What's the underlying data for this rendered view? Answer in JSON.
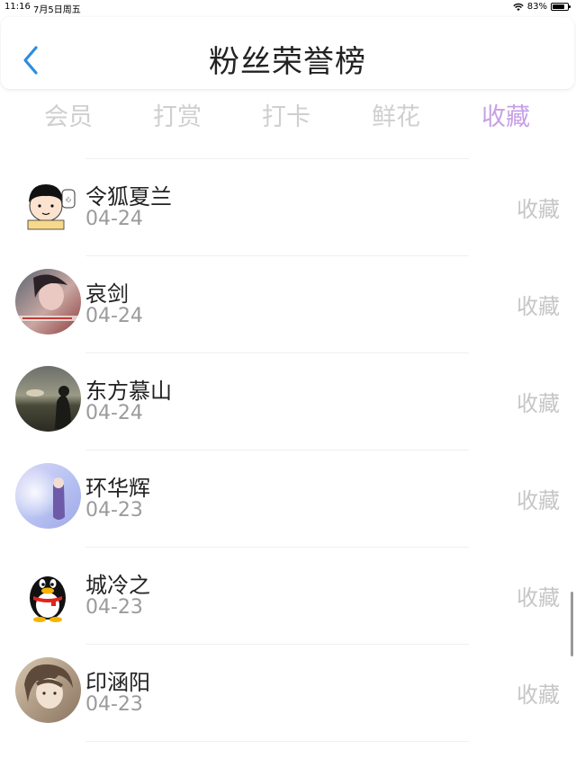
{
  "status_bar": {
    "time": "11:16",
    "date": "7月5日周五",
    "battery": "83%",
    "battery_level": 0.83
  },
  "header": {
    "title": "粉丝荣誉榜",
    "back_icon": "chevron-left-icon",
    "back_color": "#2d8de0"
  },
  "tabs": [
    {
      "label": "会员",
      "active": false
    },
    {
      "label": "打赏",
      "active": false
    },
    {
      "label": "打卡",
      "active": false
    },
    {
      "label": "鲜花",
      "active": false
    },
    {
      "label": "收藏",
      "active": true
    }
  ],
  "accent_color": "#c7a0e6",
  "fans": [
    {
      "name": "令狐夏兰",
      "date": "04-24",
      "action": "收藏",
      "avatar": "cartoon-girl-avatar"
    },
    {
      "name": "哀剑",
      "date": "04-24",
      "action": "收藏",
      "avatar": "photo-avatar"
    },
    {
      "name": "东方慕山",
      "date": "04-24",
      "action": "收藏",
      "avatar": "sunset-photo-avatar"
    },
    {
      "name": "环华辉",
      "date": "04-23",
      "action": "收藏",
      "avatar": "anime-girl-avatar"
    },
    {
      "name": "城冷之",
      "date": "04-23",
      "action": "收藏",
      "avatar": "qq-penguin-avatar"
    },
    {
      "name": "印涵阳",
      "date": "04-23",
      "action": "收藏",
      "avatar": "anime-boy-avatar"
    }
  ]
}
